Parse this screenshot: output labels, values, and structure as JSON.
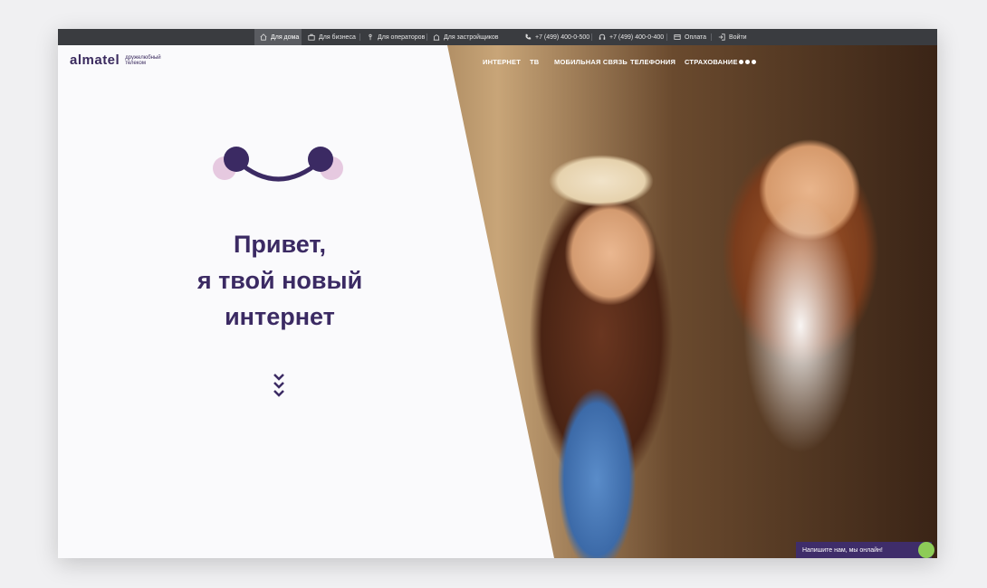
{
  "topbar": {
    "segments": [
      {
        "label": "Для дома",
        "icon": "house-icon",
        "active": true
      },
      {
        "label": "Для бизнеса",
        "icon": "briefcase-icon",
        "active": false
      },
      {
        "label": "Для операторов",
        "icon": "antenna-icon",
        "active": false
      },
      {
        "label": "Для застройщиков",
        "icon": "building-icon",
        "active": false
      }
    ],
    "phone1": "+7 (499) 400-0-500",
    "phone2": "+7 (499) 400-0-400",
    "payment": "Оплата",
    "login": "Войти"
  },
  "logo": {
    "word": "almatel",
    "tag_line1": "дружелюбный",
    "tag_line2": "телеком"
  },
  "nav": {
    "items": [
      "ИНТЕРНЕТ",
      "ТВ",
      "МОБИЛЬНАЯ СВЯЗЬ",
      "ТЕЛЕФОНИЯ",
      "СТРАХОВАНИЕ"
    ]
  },
  "hero": {
    "line1": "Привет,",
    "line2": "я твой новый",
    "line3": "интернет"
  },
  "chat": {
    "label": "Напишите нам, мы онлайн!"
  },
  "colors": {
    "brand": "#3b2a63",
    "accent_pink": "#e6c9e0",
    "topbar": "#3a3c40",
    "chat_status": "#8dcc57"
  }
}
